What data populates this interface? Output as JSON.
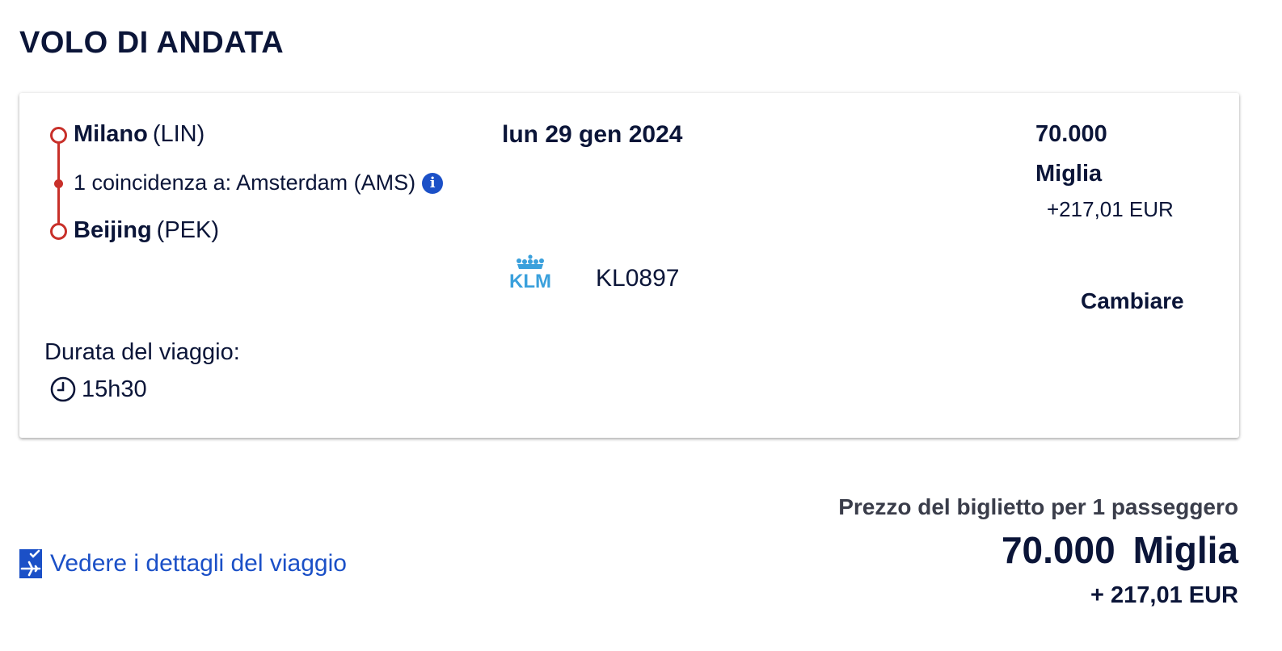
{
  "section_title": "VOLO DI ANDATA",
  "flight": {
    "origin_city": "Milano",
    "origin_code": "(LIN)",
    "connection": "1 coincidenza a: Amsterdam (AMS)",
    "destination_city": "Beijing",
    "destination_code": "(PEK)",
    "date": "lun 29 gen 2024",
    "airline": "KLM",
    "flight_number": "KL0897",
    "price_miles": "70.000",
    "price_unit": "Miglia",
    "price_eur": "+217,01 EUR",
    "change_label": "Cambiare",
    "duration_label": "Durata del viaggio:",
    "duration": "15h30"
  },
  "footer": {
    "details_link": "Vedere i dettagli del viaggio",
    "total_label": "Prezzo del biglietto per 1 passeggero",
    "total_miles": "70.000",
    "total_unit": "Miglia",
    "total_eur": "+ 217,01 EUR"
  },
  "colors": {
    "navy": "#0b1538",
    "route_red": "#c8302a",
    "link_blue": "#1b50c7",
    "klm_blue": "#3aa0dc"
  },
  "icons": [
    "info-icon",
    "klm-logo",
    "clock-icon",
    "plane-icon"
  ]
}
